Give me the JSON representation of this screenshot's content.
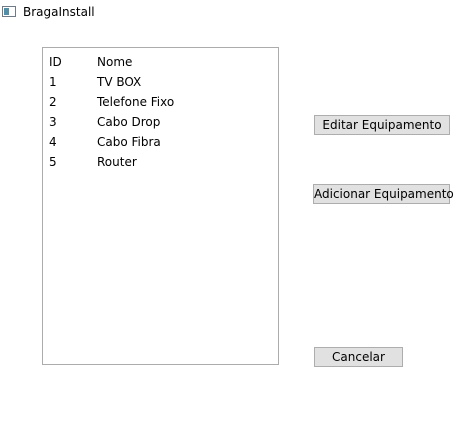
{
  "window": {
    "title": "BragaInstall"
  },
  "list": {
    "columns": [
      "ID",
      "Nome"
    ],
    "rows": [
      {
        "id": "1",
        "nome": "TV BOX"
      },
      {
        "id": "2",
        "nome": "Telefone Fixo"
      },
      {
        "id": "3",
        "nome": "Cabo Drop"
      },
      {
        "id": "4",
        "nome": "Cabo Fibra"
      },
      {
        "id": "5",
        "nome": "Router"
      }
    ]
  },
  "buttons": {
    "editar": "Editar Equipamento",
    "adicionar": "Adicionar Equipamento",
    "cancelar": "Cancelar"
  },
  "icons": {
    "app": "window-app-icon"
  },
  "colors": {
    "button_bg": "#e1e1e1",
    "button_border": "#adadad",
    "list_border": "#acacac"
  }
}
